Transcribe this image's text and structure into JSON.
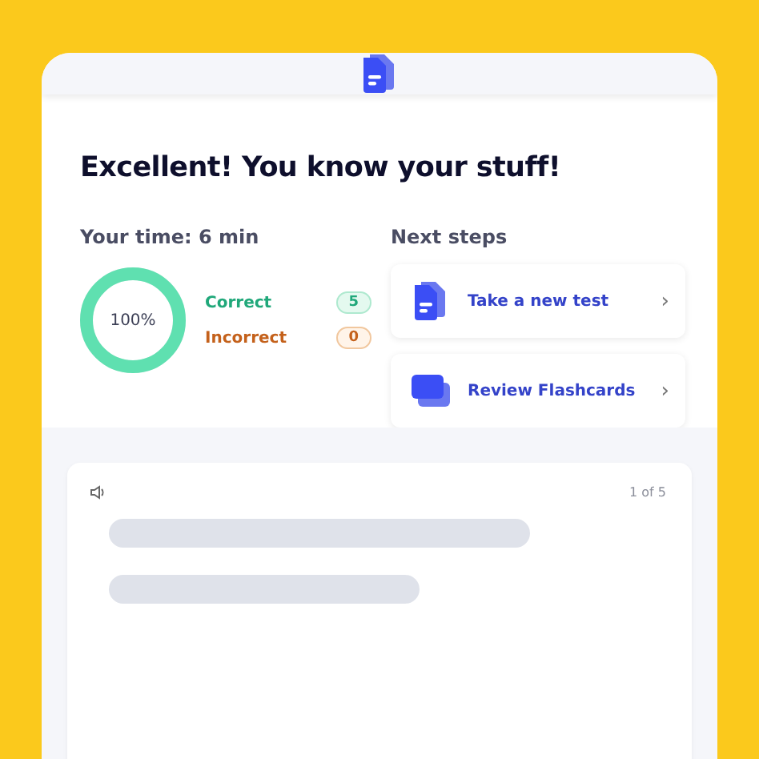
{
  "title": "Excellent! You know your stuff!",
  "time_label": "Your time: 6 min",
  "score": {
    "percent": "100%",
    "level": 1
  },
  "results": [
    {
      "kind": "correct",
      "label": "Correct",
      "count": "5"
    },
    {
      "kind": "incorrect",
      "label": "Incorrect",
      "count": "0"
    }
  ],
  "next_steps": {
    "heading": "Next steps",
    "items": [
      {
        "kind": "test",
        "label": "Take a new test",
        "chevron": "›"
      },
      {
        "kind": "flashcards",
        "label": "Review Flashcards",
        "chevron": "›"
      }
    ]
  },
  "question_card": {
    "counter": "1 of 5"
  }
}
